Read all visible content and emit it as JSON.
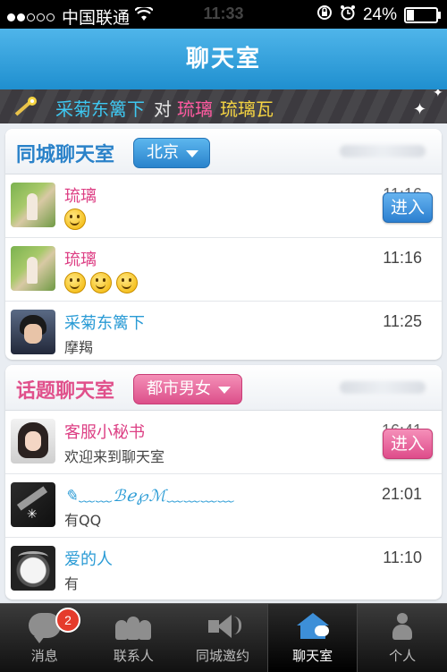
{
  "status": {
    "carrier": "中国联通",
    "time": "11:33",
    "battery": "24%"
  },
  "nav": {
    "title": "聊天室"
  },
  "banner": {
    "name1": "采菊东篱下",
    "connector": "对",
    "name2": "琉璃",
    "name3": "琉璃瓦"
  },
  "city_room": {
    "title": "同城聊天室",
    "city": "北京",
    "enter_label": "进入",
    "rows": [
      {
        "name": "琉璃",
        "time": "11:16",
        "emojis": 1
      },
      {
        "name": "琉璃",
        "time": "11:16",
        "emojis": 3
      },
      {
        "name": "采菊东篱下",
        "message": "摩羯",
        "time": "11:25"
      }
    ]
  },
  "topic_room": {
    "title": "话题聊天室",
    "topic": "都市男女",
    "enter_label": "进入",
    "rows": [
      {
        "name": "客服小秘书",
        "message": "欢迎来到聊天室",
        "time": "16:41"
      },
      {
        "name": "✎﹏﹏ℬℯ℘ℳ﹏﹏﹏﹏",
        "message": "有QQ",
        "time": "21:01"
      },
      {
        "name": "爱的人",
        "message": "有",
        "time": "11:10"
      }
    ]
  },
  "tabs": [
    {
      "label": "消息",
      "badge": "2"
    },
    {
      "label": "联系人"
    },
    {
      "label": "同城邀约"
    },
    {
      "label": "聊天室"
    },
    {
      "label": "个人"
    }
  ],
  "colors": {
    "nav_blue": "#1f8fcf",
    "pink": "#dd3f84",
    "blue_name": "#2a9bd5",
    "badge_red": "#e53b2c"
  }
}
